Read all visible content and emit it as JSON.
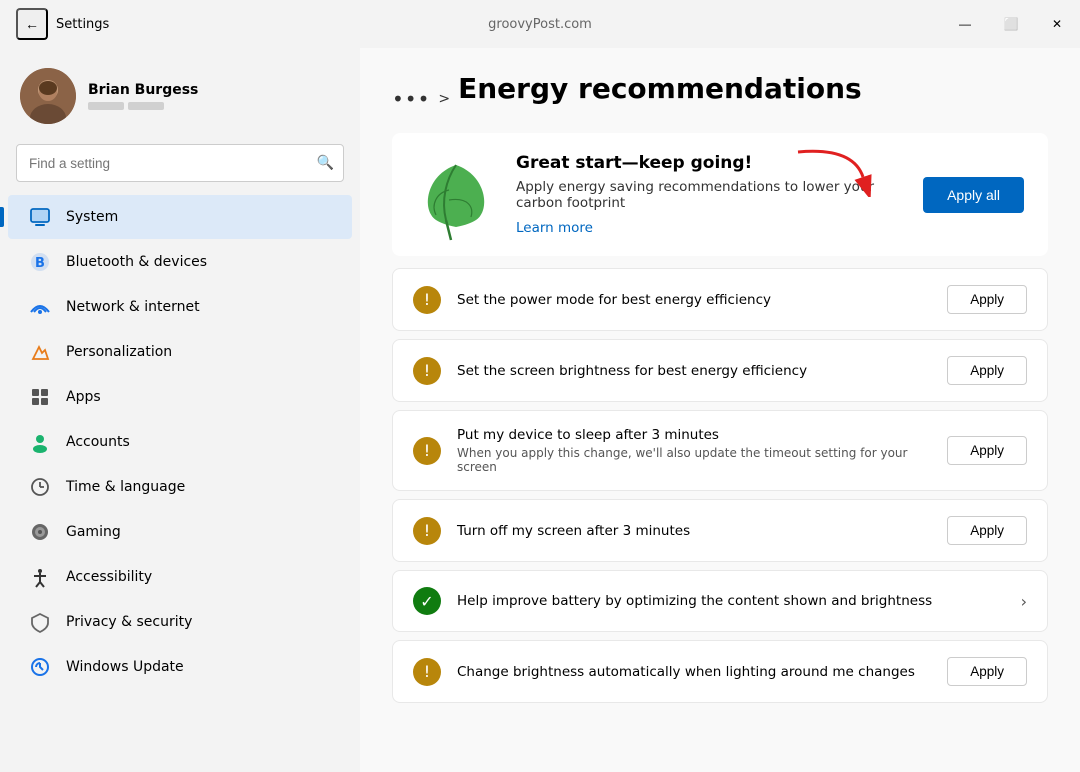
{
  "titlebar": {
    "back_label": "←",
    "title": "Settings",
    "url": "groovyPost.com",
    "minimize": "—",
    "maximize": "⬜",
    "close": "✕"
  },
  "user": {
    "name": "Brian Burgess"
  },
  "search": {
    "placeholder": "Find a setting"
  },
  "nav": {
    "items": [
      {
        "id": "system",
        "label": "System",
        "active": true
      },
      {
        "id": "bluetooth",
        "label": "Bluetooth & devices",
        "active": false
      },
      {
        "id": "network",
        "label": "Network & internet",
        "active": false
      },
      {
        "id": "personalization",
        "label": "Personalization",
        "active": false
      },
      {
        "id": "apps",
        "label": "Apps",
        "active": false
      },
      {
        "id": "accounts",
        "label": "Accounts",
        "active": false
      },
      {
        "id": "time",
        "label": "Time & language",
        "active": false
      },
      {
        "id": "gaming",
        "label": "Gaming",
        "active": false
      },
      {
        "id": "accessibility",
        "label": "Accessibility",
        "active": false
      },
      {
        "id": "privacy",
        "label": "Privacy & security",
        "active": false
      },
      {
        "id": "windows-update",
        "label": "Windows Update",
        "active": false
      }
    ]
  },
  "content": {
    "breadcrumb_dots": "•••",
    "breadcrumb_chevron": ">",
    "page_title": "Energy recommendations",
    "hero": {
      "title": "Great start—keep going!",
      "description": "Apply energy saving recommendations to lower your carbon footprint",
      "link": "Learn more",
      "apply_all_label": "Apply all"
    },
    "recommendations": [
      {
        "id": "power-mode",
        "icon_type": "warning",
        "title": "Set the power mode for best energy efficiency",
        "subtitle": "",
        "action": "apply",
        "apply_label": "Apply"
      },
      {
        "id": "screen-brightness",
        "icon_type": "warning",
        "title": "Set the screen brightness for best energy efficiency",
        "subtitle": "",
        "action": "apply",
        "apply_label": "Apply"
      },
      {
        "id": "sleep-3min",
        "icon_type": "warning",
        "title": "Put my device to sleep after 3 minutes",
        "subtitle": "When you apply this change, we'll also update the timeout setting for your screen",
        "action": "apply",
        "apply_label": "Apply"
      },
      {
        "id": "screen-off-3min",
        "icon_type": "warning",
        "title": "Turn off my screen after 3 minutes",
        "subtitle": "",
        "action": "apply",
        "apply_label": "Apply"
      },
      {
        "id": "battery-optimize",
        "icon_type": "success",
        "title": "Help improve battery by optimizing the content shown and brightness",
        "subtitle": "",
        "action": "chevron",
        "apply_label": ""
      },
      {
        "id": "auto-brightness",
        "icon_type": "warning",
        "title": "Change brightness automatically when lighting around me changes",
        "subtitle": "",
        "action": "apply",
        "apply_label": "Apply"
      }
    ]
  }
}
